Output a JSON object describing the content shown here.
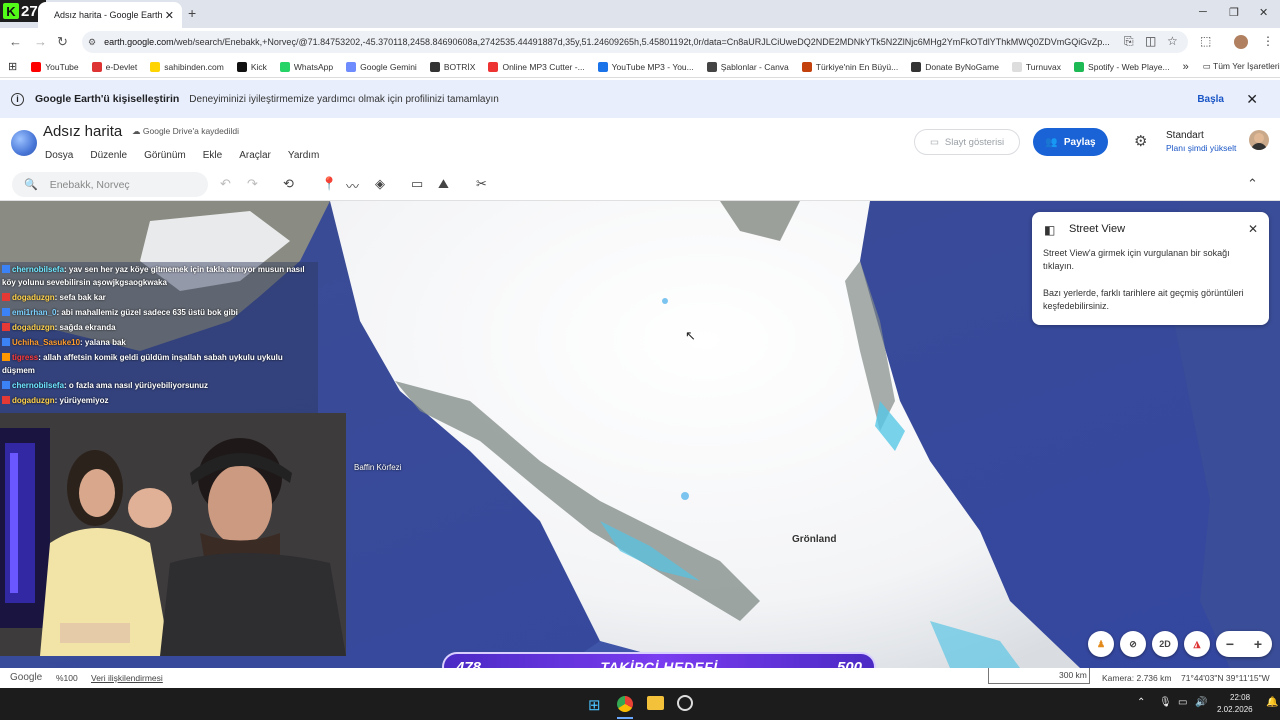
{
  "browser": {
    "tab_title": "Adsız harita - Google Earth",
    "url_host": "earth.google.com",
    "url_path": "/web/search/Enebakk,+Norveç/@71.84753202,-45.370118,2458.84690608a,2742535.44491887d,35y,51.24609265h,5.45801192t,0r/data=Cn8aURJLCiUweDQ2NDE2MDNkYTk5N2ZlNjc6MHg2YmFkOTdlYThkMWQ0ZDVmGQiGvZp...",
    "bookmarks": [
      "YouTube",
      "e-Devlet",
      "sahibinden.com",
      "Kick",
      "WhatsApp",
      "Google Gemini",
      "BOTRİX",
      "Online MP3 Cutter -...",
      "YouTube MP3 - You...",
      "Şablonlar - Canva",
      "Türkiye'nin En Büyü...",
      "Donate ByNoGame",
      "Turnuvax",
      "Spotify - Web Playe..."
    ],
    "bookmark_colors": [
      "#ff0000",
      "#d33",
      "#ffd400",
      "#111",
      "#25d366",
      "#6f8cff",
      "#333",
      "#e33",
      "#1a73e8",
      "#444",
      "#c2410c",
      "#333",
      "#ddd",
      "#1db954"
    ],
    "all_bookmarks": "Tüm Yer İşaretleri",
    "k27_label": "27"
  },
  "banner": {
    "title": "Google Earth'ü kişiselleştirin",
    "desc": "Deneyiminizi iyileştirmemize yardımcı olmak için profilinizi tamamlayın",
    "action": "Başla"
  },
  "header": {
    "map_title": "Adsız harita",
    "saved": "Google Drive'a kaydedildi",
    "menus": [
      "Dosya",
      "Düzenle",
      "Görünüm",
      "Ekle",
      "Araçlar",
      "Yardım"
    ],
    "slideshow": "Slayt gösterisi",
    "share": "Paylaş",
    "plan": "Standart",
    "upgrade": "Planı şimdi yükselt"
  },
  "toolbar": {
    "search_placeholder": "Enebakk, Norveç"
  },
  "map": {
    "label_bay": "Baffin Körfezi",
    "label_greenland": "Grönland"
  },
  "street_view": {
    "title": "Street View",
    "p1": "Street View'a girmek için vurgulanan bir sokağı tıklayın.",
    "p2": "Bazı yerlerde, farklı tarihlere ait geçmiş görüntüleri keşfedebilirsiniz."
  },
  "chat": [
    {
      "user": "chernobilsefa",
      "msg": ": yav sen her yaz köye gitmemek için takla atmıyor musun nasıl köy yolunu sevebilirsin aşowjkgsaogkwaka",
      "color": "#6ee7ff",
      "badge": "#3b82f6"
    },
    {
      "user": "dogaduzgn",
      "msg": ": sefa bak kar",
      "color": "#ffd24a",
      "badge": "#e53935"
    },
    {
      "user": "emi1rhan_0",
      "msg": ": abi mahallemiz güzel sadece 635 üstü bok gibi",
      "color": "#7ad0ff",
      "badge": "#3b82f6"
    },
    {
      "user": "dogaduzgn",
      "msg": ": sağda ekranda",
      "color": "#ffd24a",
      "badge": "#e53935"
    },
    {
      "user": "Uchiha_Sasuke10",
      "msg": ": yalana bak",
      "color": "#ff9c2a",
      "badge": "#3b82f6"
    },
    {
      "user": "tigress",
      "msg": ": allah affetsin komik geldi güldüm inşallah sabah uykulu uykulu düşmem",
      "color": "#ff3b3b",
      "badge": "#ff9800"
    },
    {
      "user": "chernobilsefa",
      "msg": ": o fazla ama nasıl yürüyebiliyorsunuz",
      "color": "#6ee7ff",
      "badge": "#3b82f6"
    },
    {
      "user": "dogaduzgn",
      "msg": ": yürüyemiyoz",
      "color": "#ffd24a",
      "badge": "#e53935"
    }
  ],
  "goal": {
    "current": "478",
    "title": "TAKİPÇİ HEDEFİ",
    "target": "500"
  },
  "controls": {
    "mode_2d": "2D"
  },
  "status": {
    "brand": "Google",
    "zoom": "%100",
    "data_attr": "Veri ilişkilendirmesi",
    "scale": "300 km",
    "camera": "Kamera: 2.736 km",
    "coords": "71°44'03\"N 39°11'15\"W"
  },
  "taskbar": {
    "time": "22:08",
    "date": "2.02.2026"
  }
}
